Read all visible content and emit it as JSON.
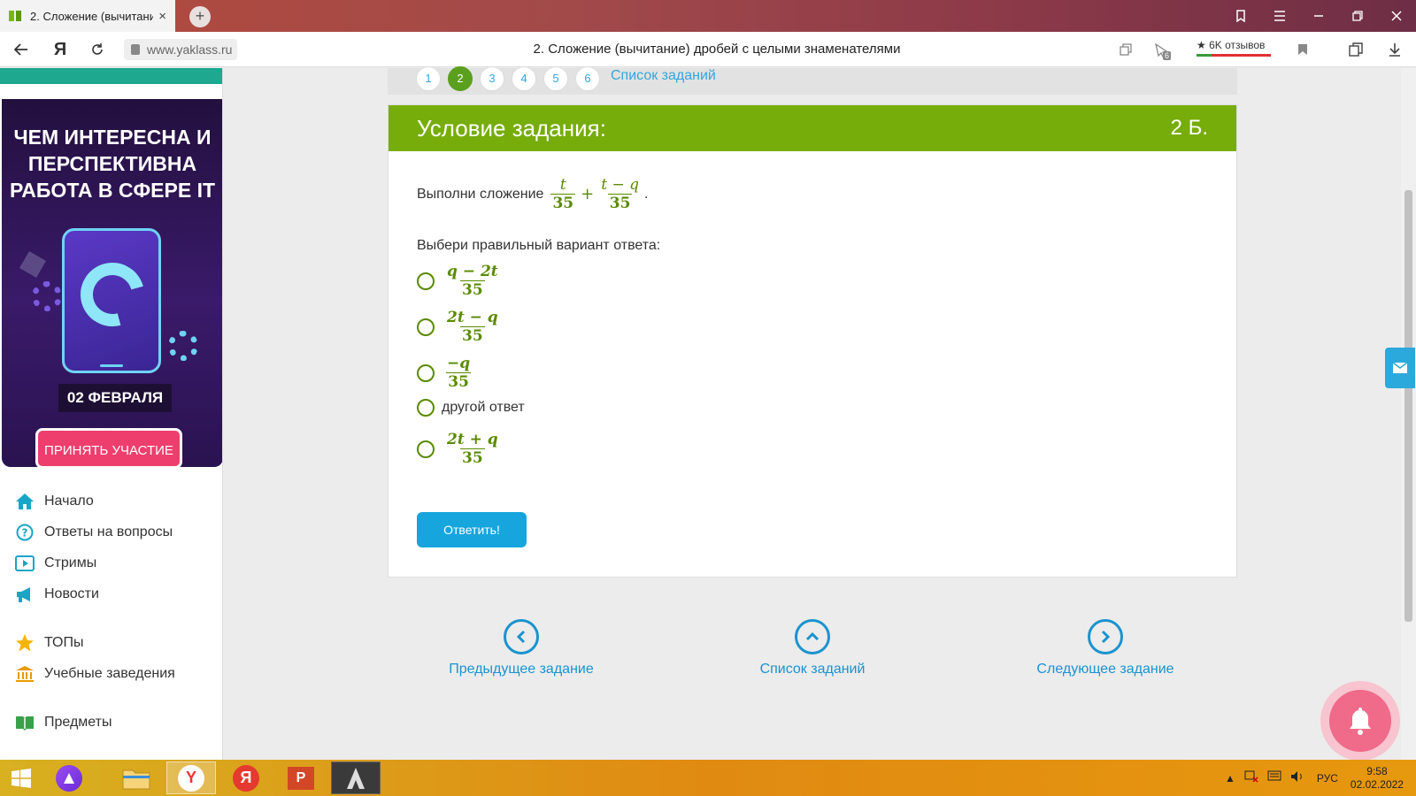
{
  "browser": {
    "tab_title": "2. Сложение (вычитани",
    "tab_close": "×",
    "new_tab": "+",
    "url": "www.yaklass.ru",
    "page_title": "2. Сложение (вычитание) дробей с целыми знаменателями",
    "reviews": "★ 6K отзывов",
    "notif_count": "6"
  },
  "sidebar": {
    "banner": {
      "headline": "ЧЕМ ИНТЕРЕСНА И ПЕРСПЕКТИВНА РАБОТА В СФЕРЕ IT",
      "date": "02 ФЕВРАЛЯ",
      "cta": "ПРИНЯТЬ УЧАСТИЕ"
    },
    "nav": [
      {
        "label": "Начало",
        "icon": "home-icon"
      },
      {
        "label": "Ответы на вопросы",
        "icon": "question-icon"
      },
      {
        "label": "Стримы",
        "icon": "play-icon"
      },
      {
        "label": "Новости",
        "icon": "megaphone-icon"
      },
      {
        "label": "ТОПы",
        "icon": "star-icon"
      },
      {
        "label": "Учебные заведения",
        "icon": "institution-icon"
      },
      {
        "label": "Предметы",
        "icon": "book-icon"
      }
    ]
  },
  "pager": {
    "pages": [
      "1",
      "2",
      "3",
      "4",
      "5",
      "6"
    ],
    "active": "2",
    "list_link": "Список заданий"
  },
  "task": {
    "header": "Условие задания:",
    "points": "2 Б.",
    "instruction": "Выполни сложение",
    "expr": {
      "a_num": "t",
      "a_den": "35",
      "op": "+",
      "b_num": "t − q",
      "b_den": "35",
      "end": "."
    },
    "prompt": "Выбери правильный вариант ответа:",
    "options": [
      {
        "num": "q − 2t",
        "den": "35"
      },
      {
        "num": "2t − q",
        "den": "35"
      },
      {
        "num": "−q",
        "den": "35"
      },
      {
        "text": "другой ответ"
      },
      {
        "num": "2t + q",
        "den": "35"
      }
    ],
    "submit": "Ответить!"
  },
  "bottom_nav": {
    "prev": "Предыдущее задание",
    "list": "Список заданий",
    "next": "Следующее задание"
  },
  "taskbar": {
    "lang": "РУС",
    "time": "9:58",
    "date": "02.02.2022"
  },
  "colors": {
    "accent_green": "#76ad0b",
    "link_blue": "#1a93cf",
    "button_blue": "#16a5dc",
    "cta_pink": "#ee3e6e"
  }
}
